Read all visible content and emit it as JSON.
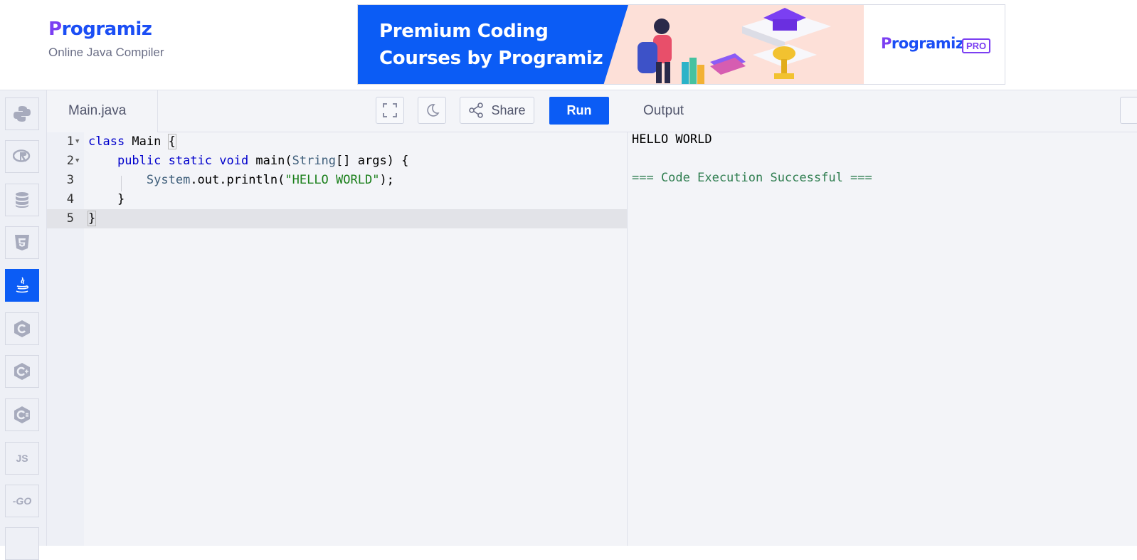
{
  "header": {
    "logo_initial": "P",
    "logo_rest": "rogramiz",
    "subtitle": "Online Java Compiler"
  },
  "ad": {
    "line1": "Premium Coding",
    "line2": "Courses by Programiz",
    "brand_initial": "P",
    "brand_rest": "rogramiz",
    "badge": "PRO",
    "colors": {
      "blue": "#0b5cf5",
      "peach": "#fde0d8",
      "purple": "#7b3ff2"
    }
  },
  "sidebar": {
    "items": [
      {
        "name": "python",
        "icon": "python-icon"
      },
      {
        "name": "r",
        "icon": "r-icon"
      },
      {
        "name": "sql",
        "icon": "database-icon"
      },
      {
        "name": "html",
        "icon": "html5-icon"
      },
      {
        "name": "java",
        "icon": "java-icon",
        "active": true
      },
      {
        "name": "c",
        "icon": "c-icon"
      },
      {
        "name": "cpp",
        "icon": "cpp-icon"
      },
      {
        "name": "csharp",
        "icon": "csharp-icon"
      },
      {
        "name": "js",
        "label": "JS"
      },
      {
        "name": "go",
        "label": "-GO"
      }
    ]
  },
  "editor": {
    "file_tab": "Main.java",
    "share_label": "Share",
    "run_label": "Run",
    "lines": [
      {
        "num": "1",
        "text": "class Main {"
      },
      {
        "num": "2",
        "text": "    public static void main(String[] args) {"
      },
      {
        "num": "3",
        "text": "        System.out.println(\"HELLO WORLD\");"
      },
      {
        "num": "4",
        "text": "    }"
      },
      {
        "num": "5",
        "text": "}"
      }
    ],
    "tokens": {
      "l1_kw": "class",
      "l1_rest": " Main ",
      "l1_brace": "{",
      "l2_indent": "    ",
      "l2_kw": "public static void",
      "l2_mid": " main(",
      "l2_ty": "String",
      "l2_rest": "[] args) {",
      "l3_indent": "        ",
      "l3_sys": "System",
      "l3_mid": ".out.println(",
      "l3_str": "\"HELLO WORLD\"",
      "l3_end": ");",
      "l4": "    }",
      "l5_brace": "}"
    }
  },
  "output": {
    "title": "Output",
    "lines": [
      "HELLO WORLD",
      "",
      "=== Code Execution Successful ==="
    ],
    "success_color": "#2e7d4f"
  }
}
